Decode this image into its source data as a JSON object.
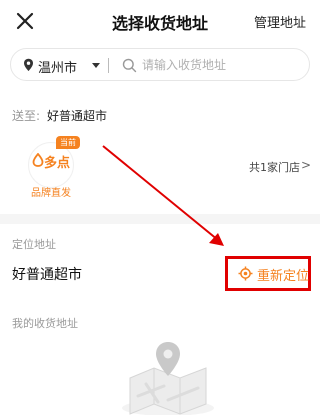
{
  "header": {
    "title": "选择收货地址",
    "manage_label": "管理地址"
  },
  "search": {
    "city": "温州市",
    "placeholder": "请输入收货地址"
  },
  "deliver": {
    "label": "送至:",
    "store_name": "好普通超市"
  },
  "store": {
    "badge": "当前",
    "logo_text": "多点",
    "brand_tag": "品牌直发",
    "count_label": "共1家门店",
    "chevron": ">"
  },
  "location": {
    "title": "定位地址",
    "name": "好普通超市",
    "relocate_label": "重新定位"
  },
  "my_address": {
    "title": "我的收货地址"
  },
  "colors": {
    "accent": "#f58220",
    "annotation_red": "#e00000"
  },
  "icons": [
    "close-icon",
    "pin-icon",
    "caret-down-icon",
    "search-icon",
    "target-icon",
    "chevron-right-icon",
    "map-pin-icon"
  ]
}
